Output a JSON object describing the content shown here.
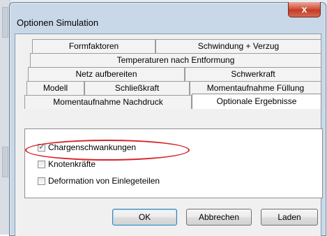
{
  "window": {
    "title": "Optionen Simulation",
    "close_glyph": "x"
  },
  "tabs": {
    "row1": [
      "Formfaktoren",
      "Schwindung + Verzug"
    ],
    "row2": [
      "Temperaturen nach Entformung"
    ],
    "row3": [
      "Netz aufbereiten",
      "Schwerkraft"
    ],
    "row4": [
      "Modell",
      "Schließkraft",
      "Momentaufnahme Füllung"
    ],
    "row5": [
      "Momentaufnahme Nachdruck",
      "Optionale Ergebnisse"
    ],
    "active": "Optionale Ergebnisse"
  },
  "options": [
    {
      "label": "Chargenschwankungen",
      "checked": true
    },
    {
      "label": "Knotenkräfte",
      "checked": false
    },
    {
      "label": "Deformation von Einlegeteilen",
      "checked": false
    }
  ],
  "buttons": {
    "ok": "OK",
    "cancel": "Abbrechen",
    "load": "Laden"
  },
  "colors": {
    "highlight": "#d8232a",
    "close_button": "#c13c26"
  }
}
